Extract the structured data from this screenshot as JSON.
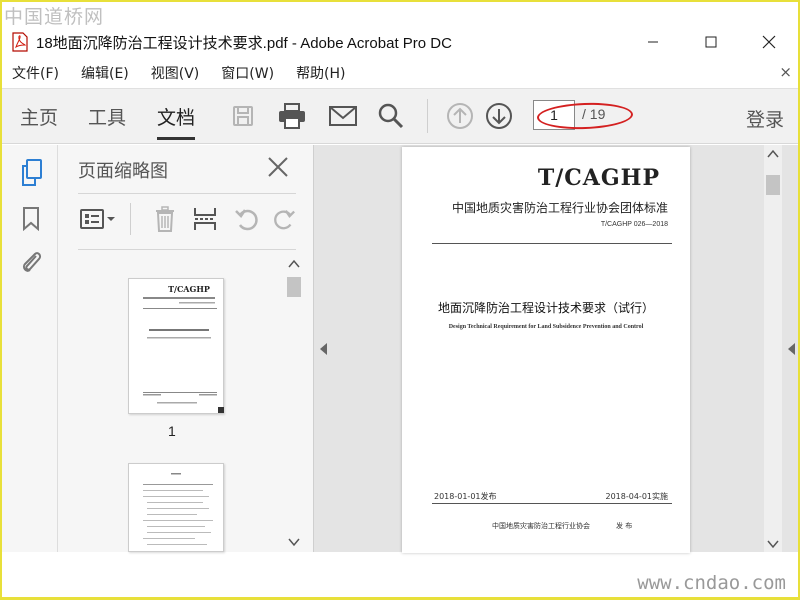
{
  "watermark": {
    "top": "中国道桥网",
    "bottom": "www.cndao.com"
  },
  "window": {
    "title": "18地面沉降防治工程设计技术要求.pdf - Adobe Acrobat Pro DC"
  },
  "menu": {
    "items": [
      {
        "label": "文件(F)"
      },
      {
        "label": "编辑(E)"
      },
      {
        "label": "视图(V)"
      },
      {
        "label": "窗口(W)"
      },
      {
        "label": "帮助(H)"
      }
    ],
    "close_symbol": "×"
  },
  "toolbar": {
    "tabs": [
      {
        "label": "主页"
      },
      {
        "label": "工具"
      },
      {
        "label": "文档",
        "active": true
      }
    ],
    "current_page": "1",
    "total_pages": "/ 19",
    "login_label": "登录",
    "icons": [
      "save-icon",
      "print-icon",
      "email-icon",
      "search-icon",
      "page-up-icon",
      "page-down-icon"
    ]
  },
  "sidebar": {
    "panel_title": "页面缩略图",
    "thumbnails": [
      {
        "label": "1"
      }
    ],
    "icons": [
      "page-thumbnails-icon",
      "bookmark-icon",
      "attachment-icon"
    ]
  },
  "document": {
    "code": "T/CAGHP",
    "organization": "中国地质灾害防治工程行业协会团体标准",
    "standard_number": "T/CAGHP 026—2018",
    "title_cn": "地面沉降防治工程设计技术要求（试行）",
    "title_en": "Design Technical Requirement for Land Subsidence Prevention and Control",
    "issue_date": "2018-01-01发布",
    "effective_date": "2018-04-01实施",
    "publisher": "中国地质灾害防治工程行业协会",
    "release_word": "发 布"
  },
  "colors": {
    "accent_blue": "#2d7fd3",
    "annotation_red": "#d42020",
    "frame_yellow": "#e8e03a"
  }
}
